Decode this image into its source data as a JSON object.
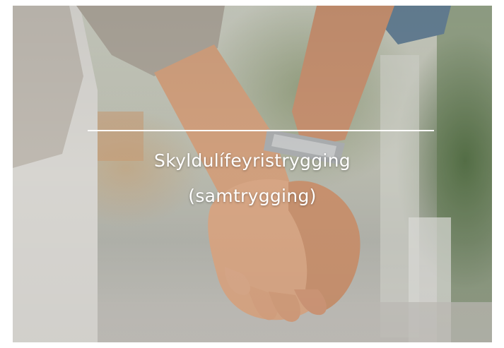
{
  "photo": {
    "caption_line1": "Skyldulífeyristrygging",
    "caption_line2": "(samtrygging)",
    "caption_color": "#ffffff"
  }
}
